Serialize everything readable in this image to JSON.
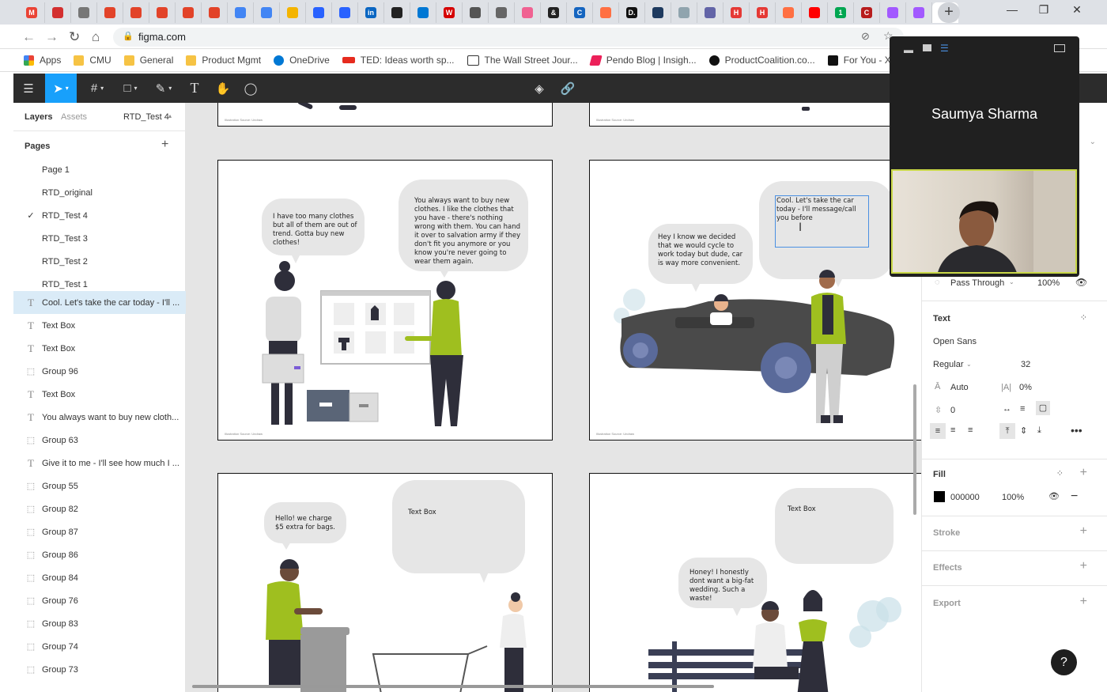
{
  "browser": {
    "tab_favicons": [
      "gmail-favicon",
      "maple-leaf-favicon",
      "globe-favicon",
      "gitlab-favicon",
      "gitlab-favicon",
      "gitlab-favicon",
      "gitlab-favicon",
      "gitlab-favicon",
      "google-docs-favicon",
      "google-docs-favicon",
      "google-slides-favicon",
      "pendo-favicon",
      "pendo-favicon",
      "linkedin-favicon",
      "dark-circle-favicon",
      "bing-favicon",
      "red-circle-favicon",
      "diagonal-favicon",
      "gear-favicon",
      "lips-favicon",
      "ampersand-favicon",
      "c-favicon",
      "cloud-favicon",
      "d-favicon",
      "blue-circle-favicon",
      "snowflake-favicon",
      "teams-favicon",
      "h-favicon",
      "h-favicon",
      "orange-favicon",
      "youtube-favicon",
      "green-circle-favicon",
      "c-red-favicon",
      "figma-favicon",
      "figma-favicon"
    ],
    "tab_letters": [
      "M",
      "",
      "",
      "",
      "",
      "",
      "",
      "",
      "",
      "",
      "",
      "",
      "",
      "in",
      "",
      "",
      "W",
      "",
      "",
      "",
      "&",
      "C",
      "",
      "D.",
      "",
      "",
      "",
      "H",
      "H",
      "",
      "",
      "1",
      "C",
      "",
      ""
    ],
    "tab_colors": [
      "#ea4335",
      "#d32f2f",
      "#777777",
      "#e24329",
      "#e24329",
      "#e24329",
      "#e24329",
      "#e24329",
      "#4285f4",
      "#4285f4",
      "#f4b400",
      "#2962ff",
      "#2962ff",
      "#0a66c2",
      "#222222",
      "#0078d4",
      "#d50000",
      "#555555",
      "#666666",
      "#f06292",
      "#222222",
      "#1565c0",
      "#ff7043",
      "#111111",
      "#1e3a5f",
      "#90a4ae",
      "#6264a7",
      "#e53935",
      "#e53935",
      "#ff7043",
      "#ff0000",
      "#00a651",
      "#b71c1c",
      "#a259ff",
      "#a259ff"
    ],
    "url": "figma.com",
    "bookmarks": [
      "Apps",
      "CMU",
      "General",
      "Product Mgmt",
      "OneDrive",
      "TED: Ideas worth sp...",
      "The Wall Street Jour...",
      "Pendo Blog | Insigh...",
      "ProductCoalition.co...",
      "For You - Xfinity Str..."
    ]
  },
  "figma": {
    "left_tabs": {
      "layers": "Layers",
      "assets": "Assets",
      "page_name": "RTD_Test 4"
    },
    "pages_title": "Pages",
    "pages": [
      "Page 1",
      "RTD_original",
      "RTD_Test 4",
      "RTD_Test 3",
      "RTD_Test 2",
      "RTD_Test 1"
    ],
    "layers": [
      {
        "type": "T",
        "name": "Cool. Let's take the car today - I'll ..."
      },
      {
        "type": "T",
        "name": "Text Box"
      },
      {
        "type": "T",
        "name": "Text Box"
      },
      {
        "type": "G",
        "name": "Group 96"
      },
      {
        "type": "T",
        "name": "Text Box"
      },
      {
        "type": "T",
        "name": "You always want to buy new cloth..."
      },
      {
        "type": "G",
        "name": "Group 63"
      },
      {
        "type": "T",
        "name": "Give it to me - I'll see how much I ..."
      },
      {
        "type": "G",
        "name": "Group 55"
      },
      {
        "type": "G",
        "name": "Group 82"
      },
      {
        "type": "G",
        "name": "Group 87"
      },
      {
        "type": "G",
        "name": "Group 86"
      },
      {
        "type": "G",
        "name": "Group 84"
      },
      {
        "type": "G",
        "name": "Group 76"
      },
      {
        "type": "G",
        "name": "Group 83"
      },
      {
        "type": "G",
        "name": "Group 74"
      },
      {
        "type": "G",
        "name": "Group 73"
      }
    ],
    "canvas": {
      "frame1": {
        "bubble_left": "I have too many clothes but all of them are out of trend. Gotta buy new clothes!",
        "bubble_right": "You always want to buy new clothes. I like the clothes that you have - there's nothing wrong with them. You can hand it over to salvation army if they don't fit you anymore or you know you're never going to wear them again."
      },
      "frame2": {
        "bubble_left": "Hey I know we decided that we would cycle to work today but dude, car is way more convenient.",
        "bubble_right": "Cool. Let's take the car today - I'll message/call you before"
      },
      "frame3": {
        "bubble_left": "Hello! we charge $5 extra for bags.",
        "bubble_right": "Text Box"
      },
      "frame4": {
        "bubble_left": "Honey! I honestly dont want a big-fat wedding. Such a waste!",
        "bubble_right": "Text Box"
      }
    },
    "right_panel": {
      "blend_mode": "Pass Through",
      "opacity": "100%",
      "text_section": "Text",
      "font_family": "Open Sans",
      "font_weight": "Regular",
      "font_size": "32",
      "line_height": "Auto",
      "letter_spacing": "0%",
      "paragraph_spacing": "0",
      "fill_section": "Fill",
      "fill_color": "000000",
      "fill_opacity": "100%",
      "stroke_section": "Stroke",
      "effects_section": "Effects",
      "export_section": "Export"
    }
  },
  "video_call": {
    "participant_name": "Saumya Sharma"
  },
  "help": "?"
}
